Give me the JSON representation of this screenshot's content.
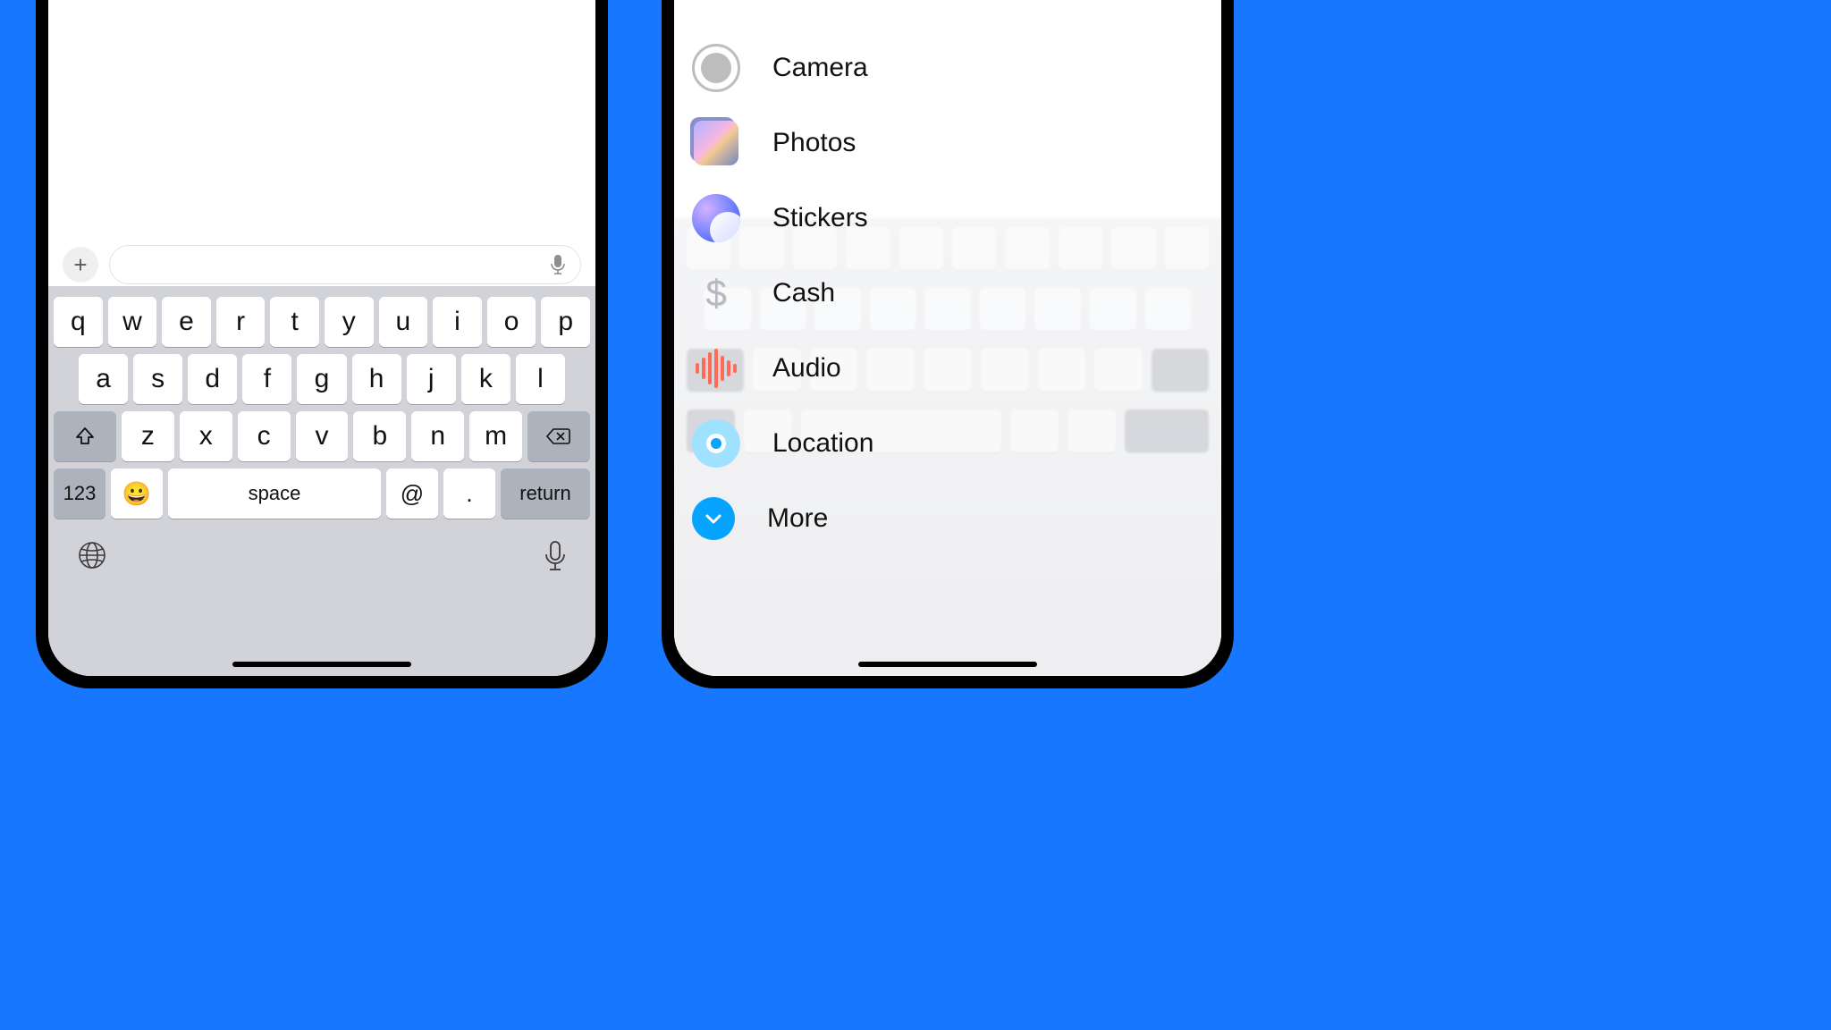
{
  "composer": {
    "plus_label": "+",
    "placeholder": ""
  },
  "keyboard": {
    "row1": [
      "q",
      "w",
      "e",
      "r",
      "t",
      "y",
      "u",
      "i",
      "o",
      "p"
    ],
    "row2": [
      "a",
      "s",
      "d",
      "f",
      "g",
      "h",
      "j",
      "k",
      "l"
    ],
    "row3": [
      "z",
      "x",
      "c",
      "v",
      "b",
      "n",
      "m"
    ],
    "numbers_key": "123",
    "space_key": "space",
    "at_key": "@",
    "dot_key": ".",
    "return_key": "return"
  },
  "menu": {
    "items": [
      {
        "id": "camera",
        "label": "Camera"
      },
      {
        "id": "photos",
        "label": "Photos"
      },
      {
        "id": "stickers",
        "label": "Stickers"
      },
      {
        "id": "cash",
        "label": "Cash"
      },
      {
        "id": "audio",
        "label": "Audio"
      },
      {
        "id": "location",
        "label": "Location"
      },
      {
        "id": "more",
        "label": "More"
      }
    ]
  }
}
